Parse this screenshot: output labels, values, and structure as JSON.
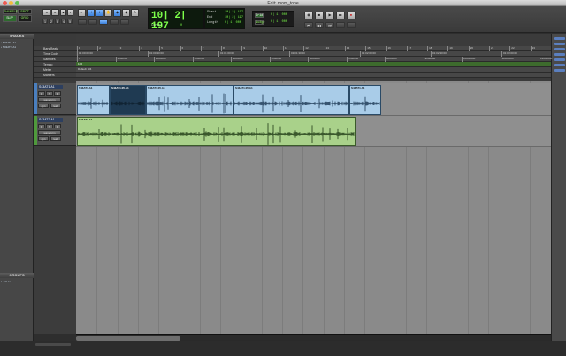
{
  "window": {
    "title": "Edit: room_tone"
  },
  "transport_counter": {
    "main": "10| 2| 197",
    "sub_label": "Cursor",
    "sub_value": "0"
  },
  "selection": {
    "start_label": "Start",
    "start_value": "10| 2| 197",
    "end_label": "End",
    "end_value": "10| 2| 197",
    "length_label": "Length",
    "length_value": "0| 1| 000"
  },
  "grid_nudge": {
    "grid_label": "Grid",
    "grid_value": "0| 1| 000",
    "nudge_label": "Nudge",
    "nudge_value": "0| 1| 000"
  },
  "mode_buttons": [
    "SHUFFLE",
    "SPOT",
    "SLIP",
    "GRID"
  ],
  "zoom_presets": [
    "1",
    "2",
    "3",
    "4",
    "5"
  ],
  "tracks_panel": {
    "title": "TRACKS",
    "items": [
      "S43AT1.A1",
      "S43AT2.A1"
    ]
  },
  "groups_panel": {
    "title": "GROUPS",
    "items": [
      "<ALL>"
    ]
  },
  "rulers": {
    "labels": [
      "Bars|Beats",
      "Time Code",
      "Samples",
      "Tempo",
      "Meter",
      "Markers"
    ],
    "bars": [
      "1",
      "2",
      "3",
      "4",
      "5",
      "6",
      "7",
      "8",
      "9",
      "10",
      "11",
      "12",
      "13",
      "14",
      "15",
      "16",
      "17",
      "18",
      "19",
      "20",
      "21",
      "22",
      "23"
    ],
    "timecode": [
      "01:00:00:00",
      "01:00:30:00",
      "01:01:00:00",
      "01:01:30:00",
      "01:02:00:00",
      "01:02:30:00",
      "01:03:00:00"
    ],
    "samples": [
      "0",
      "1000000",
      "2000000",
      "3000000",
      "4000000",
      "5000000",
      "6000000",
      "7000000",
      "8000000",
      "9000000",
      "10000000",
      "11000000",
      "12000000"
    ],
    "tempo": "120",
    "meter": "Default: 4/4"
  },
  "tracks": [
    {
      "name": "S43AT1.A1",
      "view": "waveform",
      "buttons": [
        "R",
        "S",
        "M"
      ],
      "dyn": "dyn",
      "read": "read",
      "clips": [
        "S43AT1.A1",
        "S43AT1.05.A1",
        "S43AT1.05.A1",
        "S43AT1.05.A1",
        "S43AT1.A1"
      ]
    },
    {
      "name": "S43AT2.A1",
      "view": "waveform",
      "buttons": [
        "R",
        "S",
        "M"
      ],
      "dyn": "dyn",
      "read": "read",
      "clips": [
        "S43AT2.A1"
      ]
    }
  ],
  "scroll": {
    "horizontal_visible_fraction": 0.22
  }
}
